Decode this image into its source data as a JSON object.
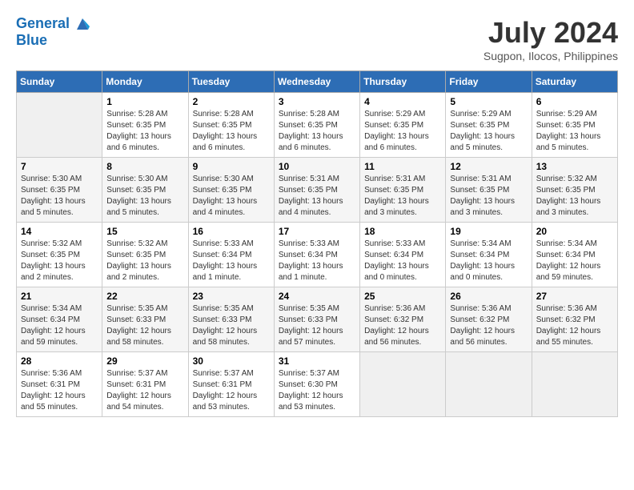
{
  "header": {
    "logo_line1": "General",
    "logo_line2": "Blue",
    "month_year": "July 2024",
    "location": "Sugpon, Ilocos, Philippines"
  },
  "days_of_week": [
    "Sunday",
    "Monday",
    "Tuesday",
    "Wednesday",
    "Thursday",
    "Friday",
    "Saturday"
  ],
  "weeks": [
    [
      {
        "day": "",
        "info": ""
      },
      {
        "day": "1",
        "info": "Sunrise: 5:28 AM\nSunset: 6:35 PM\nDaylight: 13 hours\nand 6 minutes."
      },
      {
        "day": "2",
        "info": "Sunrise: 5:28 AM\nSunset: 6:35 PM\nDaylight: 13 hours\nand 6 minutes."
      },
      {
        "day": "3",
        "info": "Sunrise: 5:28 AM\nSunset: 6:35 PM\nDaylight: 13 hours\nand 6 minutes."
      },
      {
        "day": "4",
        "info": "Sunrise: 5:29 AM\nSunset: 6:35 PM\nDaylight: 13 hours\nand 6 minutes."
      },
      {
        "day": "5",
        "info": "Sunrise: 5:29 AM\nSunset: 6:35 PM\nDaylight: 13 hours\nand 5 minutes."
      },
      {
        "day": "6",
        "info": "Sunrise: 5:29 AM\nSunset: 6:35 PM\nDaylight: 13 hours\nand 5 minutes."
      }
    ],
    [
      {
        "day": "7",
        "info": "Sunrise: 5:30 AM\nSunset: 6:35 PM\nDaylight: 13 hours\nand 5 minutes."
      },
      {
        "day": "8",
        "info": "Sunrise: 5:30 AM\nSunset: 6:35 PM\nDaylight: 13 hours\nand 5 minutes."
      },
      {
        "day": "9",
        "info": "Sunrise: 5:30 AM\nSunset: 6:35 PM\nDaylight: 13 hours\nand 4 minutes."
      },
      {
        "day": "10",
        "info": "Sunrise: 5:31 AM\nSunset: 6:35 PM\nDaylight: 13 hours\nand 4 minutes."
      },
      {
        "day": "11",
        "info": "Sunrise: 5:31 AM\nSunset: 6:35 PM\nDaylight: 13 hours\nand 3 minutes."
      },
      {
        "day": "12",
        "info": "Sunrise: 5:31 AM\nSunset: 6:35 PM\nDaylight: 13 hours\nand 3 minutes."
      },
      {
        "day": "13",
        "info": "Sunrise: 5:32 AM\nSunset: 6:35 PM\nDaylight: 13 hours\nand 3 minutes."
      }
    ],
    [
      {
        "day": "14",
        "info": "Sunrise: 5:32 AM\nSunset: 6:35 PM\nDaylight: 13 hours\nand 2 minutes."
      },
      {
        "day": "15",
        "info": "Sunrise: 5:32 AM\nSunset: 6:35 PM\nDaylight: 13 hours\nand 2 minutes."
      },
      {
        "day": "16",
        "info": "Sunrise: 5:33 AM\nSunset: 6:34 PM\nDaylight: 13 hours\nand 1 minute."
      },
      {
        "day": "17",
        "info": "Sunrise: 5:33 AM\nSunset: 6:34 PM\nDaylight: 13 hours\nand 1 minute."
      },
      {
        "day": "18",
        "info": "Sunrise: 5:33 AM\nSunset: 6:34 PM\nDaylight: 13 hours\nand 0 minutes."
      },
      {
        "day": "19",
        "info": "Sunrise: 5:34 AM\nSunset: 6:34 PM\nDaylight: 13 hours\nand 0 minutes."
      },
      {
        "day": "20",
        "info": "Sunrise: 5:34 AM\nSunset: 6:34 PM\nDaylight: 12 hours\nand 59 minutes."
      }
    ],
    [
      {
        "day": "21",
        "info": "Sunrise: 5:34 AM\nSunset: 6:34 PM\nDaylight: 12 hours\nand 59 minutes."
      },
      {
        "day": "22",
        "info": "Sunrise: 5:35 AM\nSunset: 6:33 PM\nDaylight: 12 hours\nand 58 minutes."
      },
      {
        "day": "23",
        "info": "Sunrise: 5:35 AM\nSunset: 6:33 PM\nDaylight: 12 hours\nand 58 minutes."
      },
      {
        "day": "24",
        "info": "Sunrise: 5:35 AM\nSunset: 6:33 PM\nDaylight: 12 hours\nand 57 minutes."
      },
      {
        "day": "25",
        "info": "Sunrise: 5:36 AM\nSunset: 6:32 PM\nDaylight: 12 hours\nand 56 minutes."
      },
      {
        "day": "26",
        "info": "Sunrise: 5:36 AM\nSunset: 6:32 PM\nDaylight: 12 hours\nand 56 minutes."
      },
      {
        "day": "27",
        "info": "Sunrise: 5:36 AM\nSunset: 6:32 PM\nDaylight: 12 hours\nand 55 minutes."
      }
    ],
    [
      {
        "day": "28",
        "info": "Sunrise: 5:36 AM\nSunset: 6:31 PM\nDaylight: 12 hours\nand 55 minutes."
      },
      {
        "day": "29",
        "info": "Sunrise: 5:37 AM\nSunset: 6:31 PM\nDaylight: 12 hours\nand 54 minutes."
      },
      {
        "day": "30",
        "info": "Sunrise: 5:37 AM\nSunset: 6:31 PM\nDaylight: 12 hours\nand 53 minutes."
      },
      {
        "day": "31",
        "info": "Sunrise: 5:37 AM\nSunset: 6:30 PM\nDaylight: 12 hours\nand 53 minutes."
      },
      {
        "day": "",
        "info": ""
      },
      {
        "day": "",
        "info": ""
      },
      {
        "day": "",
        "info": ""
      }
    ]
  ]
}
